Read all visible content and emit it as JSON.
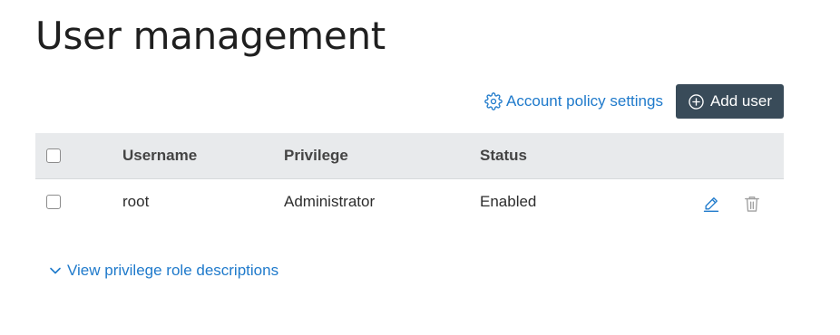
{
  "page": {
    "title": "User management"
  },
  "toolbar": {
    "account_policy_label": "Account policy settings",
    "account_policy_icon": "gear-icon",
    "add_user_label": "Add user",
    "add_user_icon": "plus-circle-icon"
  },
  "table": {
    "columns": [
      "Username",
      "Privilege",
      "Status"
    ],
    "rows": [
      {
        "username": "root",
        "privilege": "Administrator",
        "status": "Enabled",
        "selected": false,
        "actions": [
          "edit-icon",
          "trash-icon"
        ]
      }
    ],
    "select_all": false
  },
  "footer": {
    "expander_label": "View privilege role descriptions",
    "expander_icon": "chevron-down-icon"
  },
  "colors": {
    "link": "#1f7acb",
    "primary_button": "#394b59",
    "header_bg": "#e8eaec",
    "delete_icon_disabled": "#a0a0a0"
  }
}
